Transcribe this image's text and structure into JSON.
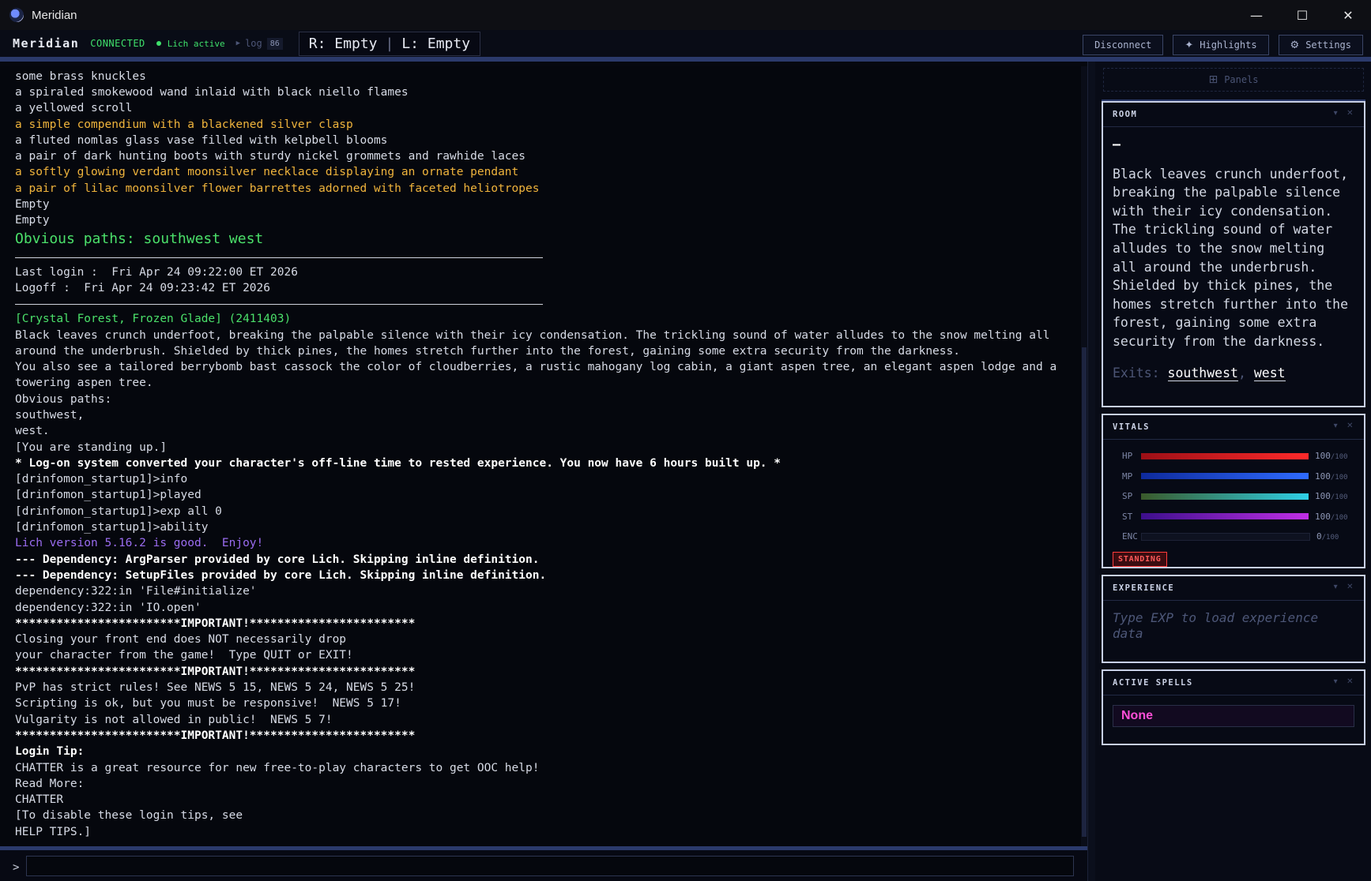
{
  "window": {
    "title": "Meridian",
    "minimize": "—",
    "maximize": "☐",
    "close": "✕"
  },
  "toolbar": {
    "brand": "Meridian",
    "status": "CONNECTED",
    "lich": "Lich active",
    "log_label": "log",
    "log_count": "86",
    "right_hand": "R: Empty",
    "left_hand": "L: Empty",
    "disconnect": "Disconnect",
    "highlights": "Highlights",
    "settings": "Settings"
  },
  "game_lines": [
    {
      "t": "some brass knuckles",
      "c": ""
    },
    {
      "t": "a spiraled smokewood wand inlaid with black niello flames",
      "c": ""
    },
    {
      "t": "a yellowed scroll",
      "c": ""
    },
    {
      "t": "a simple compendium with a blackened silver clasp",
      "c": "yellow"
    },
    {
      "t": "a fluted nomlas glass vase filled with kelpbell blooms",
      "c": ""
    },
    {
      "t": "a pair of dark hunting boots with sturdy nickel grommets and rawhide laces",
      "c": ""
    },
    {
      "t": "a softly glowing verdant moonsilver necklace displaying an ornate pendant",
      "c": "yellow"
    },
    {
      "t": "a pair of lilac moonsilver flower barrettes adorned with faceted heliotropes",
      "c": "yellow"
    },
    {
      "t": "Empty",
      "c": ""
    },
    {
      "t": "Empty",
      "c": ""
    },
    {
      "t": "Obvious paths: southwest west",
      "c": "green big"
    },
    {
      "t": "",
      "c": "rule"
    },
    {
      "t": "Last login :  Fri Apr 24 09:22:00 ET 2026",
      "c": ""
    },
    {
      "t": "Logoff :  Fri Apr 24 09:23:42 ET 2026",
      "c": ""
    },
    {
      "t": "",
      "c": "rule"
    },
    {
      "t": "[Crystal Forest, Frozen Glade] (2411403)",
      "c": "green"
    },
    {
      "t": "Black leaves crunch underfoot, breaking the palpable silence with their icy condensation. The trickling sound of water alludes to the snow melting all around the underbrush. Shielded by thick pines, the homes stretch further into the forest, gaining some extra security from the darkness.",
      "c": ""
    },
    {
      "t": "You also see a tailored berrybomb bast cassock the color of cloudberries, a rustic mahogany log cabin, a giant aspen tree, an elegant aspen lodge and a towering aspen tree.",
      "c": ""
    },
    {
      "t": "Obvious paths:",
      "c": ""
    },
    {
      "t": "southwest,",
      "c": ""
    },
    {
      "t": "west.",
      "c": ""
    },
    {
      "t": "[You are standing up.]",
      "c": ""
    },
    {
      "t": "* Log-on system converted your character's off-line time to rested experience. You now have 6 hours built up. *",
      "c": "bold"
    },
    {
      "t": "[drinfomon_startup1]>info",
      "c": ""
    },
    {
      "t": "[drinfomon_startup1]>played",
      "c": ""
    },
    {
      "t": "[drinfomon_startup1]>exp all 0",
      "c": ""
    },
    {
      "t": "[drinfomon_startup1]>ability",
      "c": ""
    },
    {
      "t": "Lich version 5.16.2 is good.  Enjoy!",
      "c": "purple"
    },
    {
      "t": "--- Dependency: ArgParser provided by core Lich. Skipping inline definition.",
      "c": "bold"
    },
    {
      "t": "--- Dependency: SetupFiles provided by core Lich. Skipping inline definition.",
      "c": "bold"
    },
    {
      "t": "dependency:322:in 'File#initialize'",
      "c": ""
    },
    {
      "t": "dependency:322:in 'IO.open'",
      "c": ""
    },
    {
      "t": "************************IMPORTANT!************************",
      "c": "bold"
    },
    {
      "t": "Closing your front end does NOT necessarily drop",
      "c": ""
    },
    {
      "t": "your character from the game!  Type QUIT or EXIT!",
      "c": ""
    },
    {
      "t": "************************IMPORTANT!************************",
      "c": "bold"
    },
    {
      "t": "PvP has strict rules! See NEWS 5 15, NEWS 5 24, NEWS 5 25!",
      "c": ""
    },
    {
      "t": "Scripting is ok, but you must be responsive!  NEWS 5 17!",
      "c": ""
    },
    {
      "t": "Vulgarity is not allowed in public!  NEWS 5 7!",
      "c": ""
    },
    {
      "t": "************************IMPORTANT!************************",
      "c": "bold"
    },
    {
      "t": "Login Tip:",
      "c": "bold"
    },
    {
      "t": "CHATTER is a great resource for new free-to-play characters to get OOC help!",
      "c": ""
    },
    {
      "t": "Read More:",
      "c": ""
    },
    {
      "t": "CHATTER",
      "c": ""
    },
    {
      "t": "[To disable these login tips, see",
      "c": ""
    },
    {
      "t": "HELP TIPS.]",
      "c": ""
    }
  ],
  "input": {
    "prompt": ">",
    "value": ""
  },
  "side": {
    "panels_label": "Panels",
    "room": {
      "title": "ROOM",
      "name": "—",
      "desc": "Black leaves crunch underfoot, breaking the palpable silence with their icy condensation. The trickling sound of water alludes to the snow melting all around the underbrush. Shielded by thick pines, the homes stretch further into the forest, gaining some extra security from the darkness.",
      "exits_label": "Exits:",
      "exits": [
        "southwest",
        "west"
      ]
    },
    "vitals": {
      "title": "VITALS",
      "bars": [
        {
          "label": "HP",
          "value": "100",
          "max": "/100",
          "pct": 1.0,
          "from": "#9c0f16",
          "to": "#ff2a2a"
        },
        {
          "label": "MP",
          "value": "100",
          "max": "/100",
          "pct": 1.0,
          "from": "#0e2a9c",
          "to": "#2f6bff"
        },
        {
          "label": "SP",
          "value": "100",
          "max": "/100",
          "pct": 1.0,
          "from": "#3a5a2a",
          "to": "#2fd0e6"
        },
        {
          "label": "ST",
          "value": "100",
          "max": "/100",
          "pct": 1.0,
          "from": "#3c0f8c",
          "to": "#c02fe6"
        },
        {
          "label": "ENC",
          "value": "0",
          "max": "/100",
          "pct": 0.0,
          "from": "#444",
          "to": "#666"
        }
      ],
      "status": "STANDING"
    },
    "experience": {
      "title": "EXPERIENCE",
      "placeholder": "Type EXP to load experience data"
    },
    "spells": {
      "title": "ACTIVE SPELLS",
      "none": "None"
    }
  }
}
